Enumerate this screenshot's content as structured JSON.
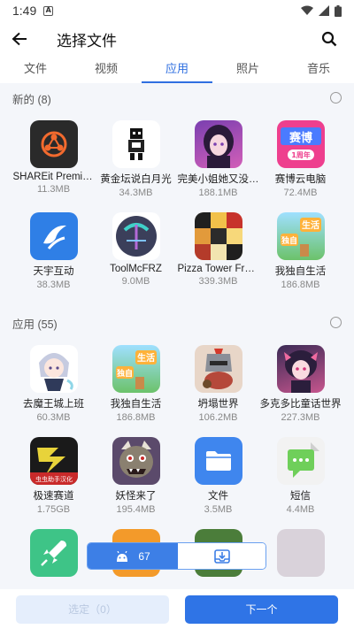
{
  "status": {
    "time": "1:49"
  },
  "header": {
    "title": "选择文件"
  },
  "tabs": [
    {
      "label": "文件",
      "active": false
    },
    {
      "label": "视频",
      "active": false
    },
    {
      "label": "应用",
      "active": true
    },
    {
      "label": "照片",
      "active": false
    },
    {
      "label": "音乐",
      "active": false
    }
  ],
  "sections": {
    "new": {
      "header": "新的 (8)",
      "items": [
        {
          "name": "SHAREit Premium",
          "size": "11.3MB",
          "icon": "shareit-icon"
        },
        {
          "name": "黄金坛说白月光",
          "size": "34.3MB",
          "icon": "pixel-figure-icon"
        },
        {
          "name": "完美小姐她又没…",
          "size": "188.1MB",
          "icon": "anime-girl-icon"
        },
        {
          "name": "赛博云电脑",
          "size": "72.4MB",
          "icon": "cyber-cloud-icon"
        },
        {
          "name": "天宇互动",
          "size": "38.3MB",
          "icon": "tianyu-icon"
        },
        {
          "name": "ToolMcFRZ",
          "size": "9.0MB",
          "icon": "pickaxe-icon"
        },
        {
          "name": "Pizza Tower Fre…",
          "size": "339.3MB",
          "icon": "pizza-tower-icon"
        },
        {
          "name": "我独自生活",
          "size": "186.8MB",
          "icon": "life-game-icon"
        }
      ]
    },
    "apps": {
      "header": "应用 (55)",
      "items": [
        {
          "name": "去魔王城上班",
          "size": "60.3MB",
          "icon": "chibi-girl-icon"
        },
        {
          "name": "我独自生活",
          "size": "186.8MB",
          "icon": "life-game-icon"
        },
        {
          "name": "坍塌世界",
          "size": "106.2MB",
          "icon": "knight-icon"
        },
        {
          "name": "多克多比童话世界",
          "size": "227.3MB",
          "icon": "fairy-girl-icon"
        },
        {
          "name": "极速赛道",
          "size": "1.75GB",
          "icon": "racing-icon"
        },
        {
          "name": "妖怪来了",
          "size": "195.4MB",
          "icon": "monster-icon"
        },
        {
          "name": "文件",
          "size": "3.5MB",
          "icon": "folder-icon"
        },
        {
          "name": "短信",
          "size": "4.4MB",
          "icon": "sms-icon"
        }
      ],
      "partial": [
        "rocket-icon",
        "orange-game-icon",
        "pixel-field-icon",
        "boy-icon"
      ]
    }
  },
  "floating": {
    "count": "67"
  },
  "footer": {
    "confirm_label": "选定（0）",
    "next_label": "下一个"
  },
  "colors": {
    "accent": "#2f6fe0",
    "primary_button": "#2f74e6"
  }
}
